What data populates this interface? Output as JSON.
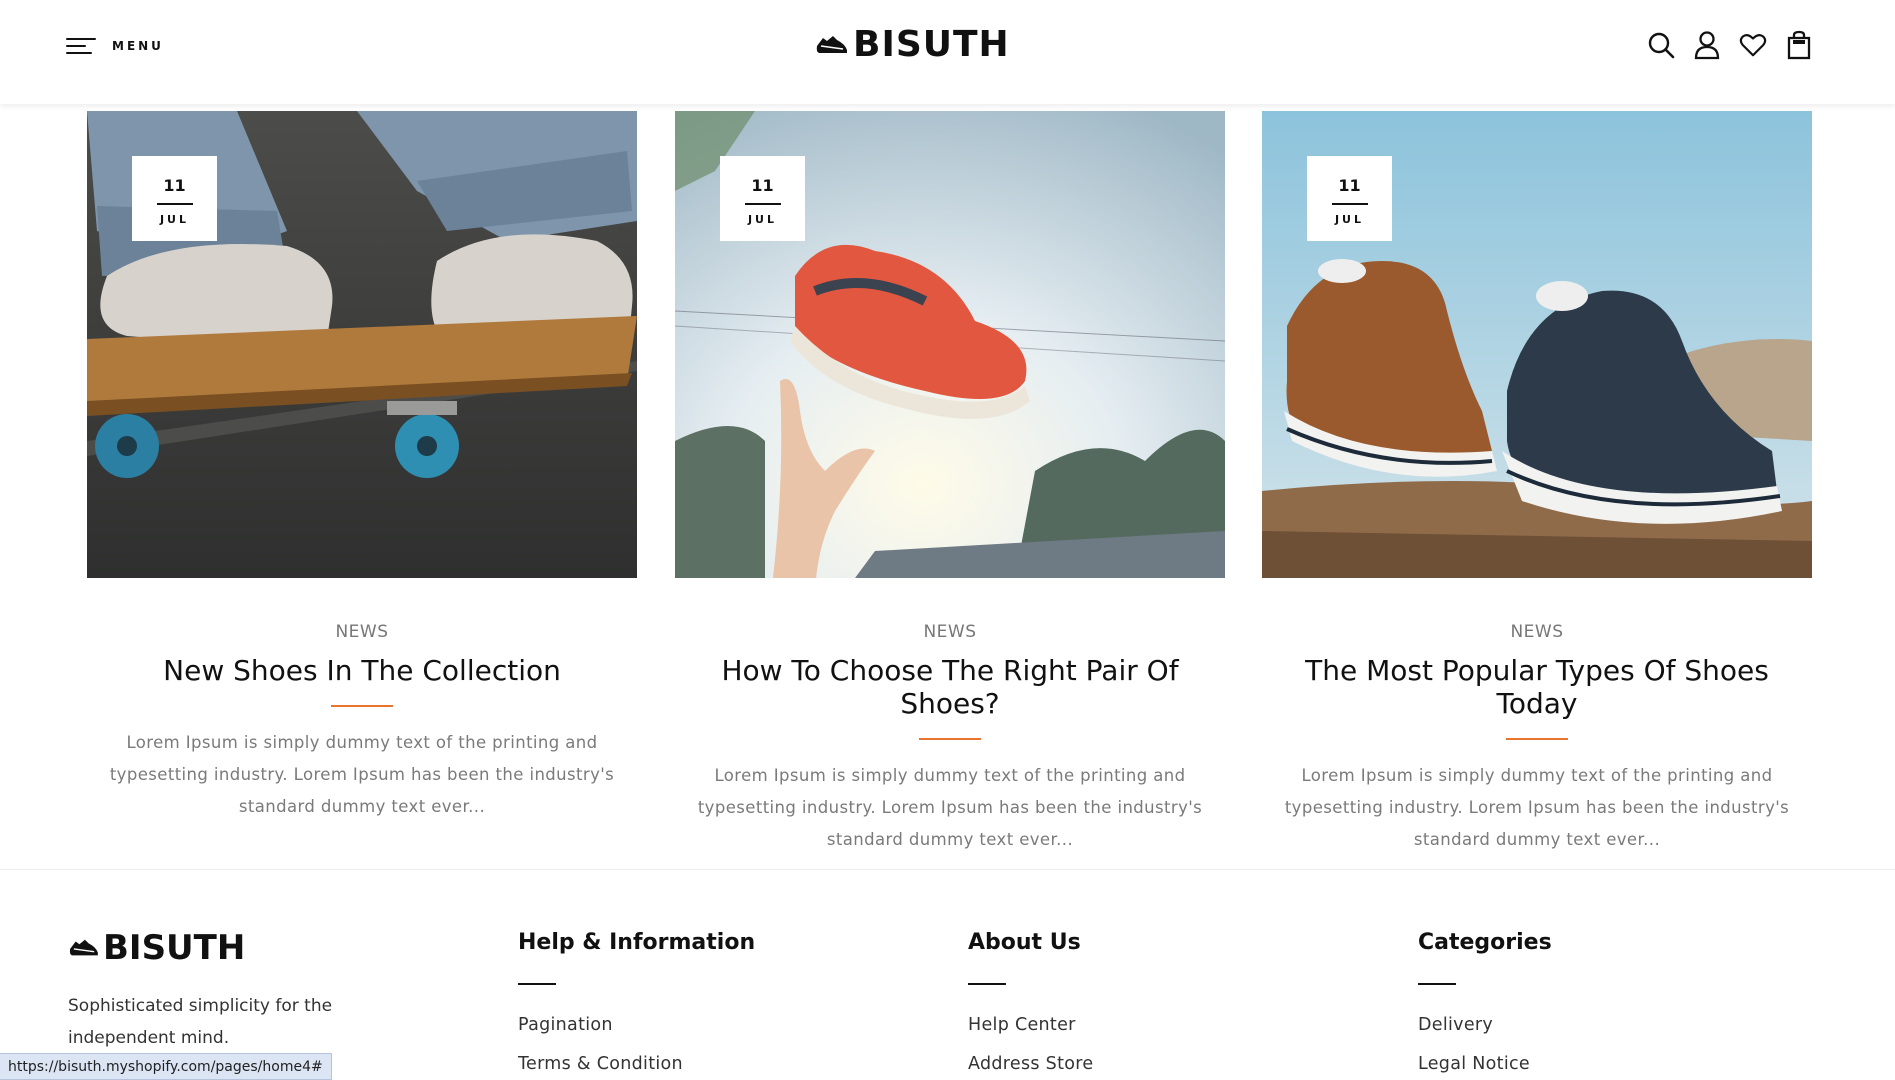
{
  "header": {
    "menu_label": "MENU",
    "logo_text": "BISUTH",
    "icons": [
      "search-icon",
      "user-icon",
      "heart-icon",
      "cart-icon"
    ]
  },
  "posts": [
    {
      "day": "11",
      "month": "JUL",
      "category": "NEWS",
      "title": "New Shoes In The Collection",
      "excerpt": "Lorem Ipsum is simply dummy text of the printing and typesetting industry. Lorem Ipsum has been the industry's standard dummy text ever...",
      "image": "sneakers-on-skateboard"
    },
    {
      "day": "11",
      "month": "JUL",
      "category": "NEWS",
      "title": "How To Choose The Right Pair Of Shoes?",
      "excerpt": "Lorem Ipsum is simply dummy text of the printing and typesetting industry. Lorem Ipsum has been the industry's standard dummy text ever...",
      "image": "sneaker-tossed-in-air"
    },
    {
      "day": "11",
      "month": "JUL",
      "category": "NEWS",
      "title": "The Most Popular Types Of Shoes Today",
      "excerpt": "Lorem Ipsum is simply dummy text of the printing and typesetting industry. Lorem Ipsum has been the industry's standard dummy text ever...",
      "image": "canvas-shoes-on-rock"
    }
  ],
  "footer": {
    "logo_text": "BISUTH",
    "tagline": "Sophisticated simplicity for the independent mind.",
    "columns": [
      {
        "heading": "Help & Information",
        "links": [
          "Pagination",
          "Terms & Condition"
        ]
      },
      {
        "heading": "About Us",
        "links": [
          "Help Center",
          "Address Store"
        ]
      },
      {
        "heading": "Categories",
        "links": [
          "Delivery",
          "Legal Notice"
        ]
      }
    ]
  },
  "status_url": "https://bisuth.myshopify.com/pages/home4#",
  "colors": {
    "accent": "#e8742e",
    "text": "#111111",
    "muted": "#7a7a7a"
  }
}
